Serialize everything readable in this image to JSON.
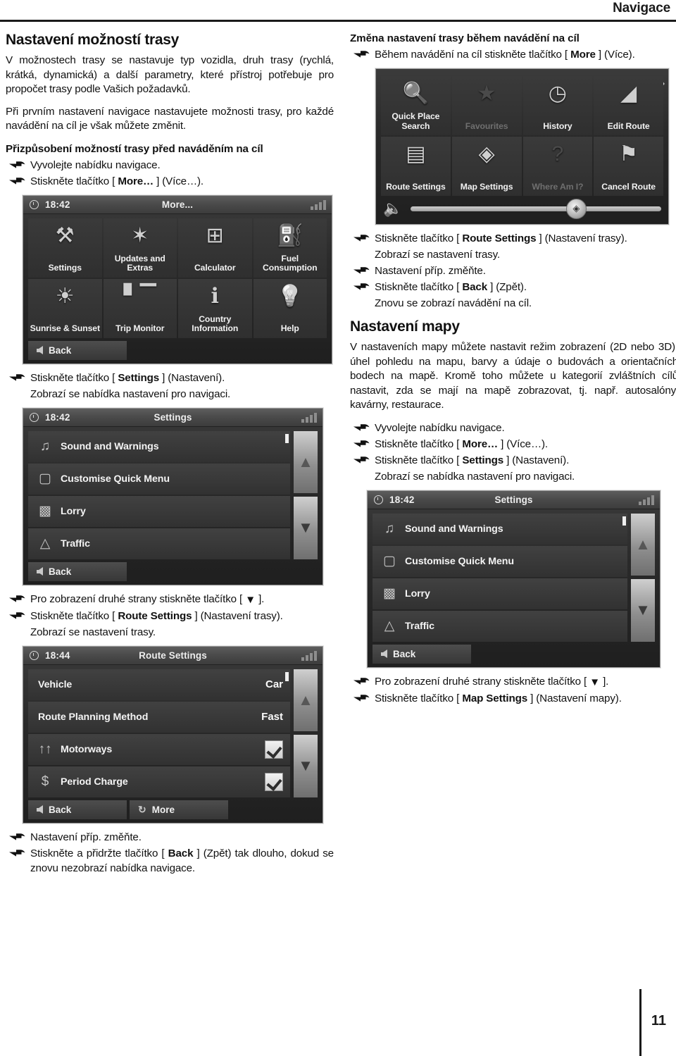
{
  "header": {
    "title": "Navigace"
  },
  "footer": {
    "page_number": "11"
  },
  "left": {
    "section_title": "Nastavení možností trasy",
    "intro_p1": "V možnostech trasy se nastavuje typ vozidla, druh trasy (rychlá, krátká, dynamická) a další parametry, které přístroj potřebuje pro propočet trasy podle Vašich požadavků.",
    "intro_p2": "Při prvním nastavení navigace nastavujete možnosti trasy, pro každé navádění na cíl je však můžete změnit.",
    "sub_title": "Přizpůsobení možností trasy před naváděním na cíl",
    "step1": "Vyvolejte nabídku navigace.",
    "step2_pre": "Stiskněte tlačítko [ ",
    "step2_bold": "More…",
    "step2_post": " ] (Více…).",
    "step3_pre": "Stiskněte tlačítko [ ",
    "step3_bold": "Settings",
    "step3_post": " ] (Nastavení).",
    "step3_note": "Zobrazí se nabídka nastavení pro navigaci.",
    "step4_pre": "Pro zobrazení druhé strany stiskněte tlačítko [ ",
    "step4_glyph": "▼",
    "step4_post": " ].",
    "step5_pre": "Stiskněte tlačítko [ ",
    "step5_bold": "Route Settings",
    "step5_post": " ] (Nastavení trasy).",
    "step5_note": "Zobrazí se nastavení trasy.",
    "step6": "Nastavení příp. změňte.",
    "step7_pre": "Stiskněte a přidržte tlačítko [ ",
    "step7_bold": "Back",
    "step7_post": " ] (Zpět) tak dlouho, dokud se znovu nezobrazí nabídka navigace."
  },
  "right": {
    "sub_title": "Změna nastavení trasy během navádění na cíl",
    "step1_pre": "Během navádění na cíl stiskněte tlačítko [ ",
    "step1_bold": "More",
    "step1_post": " ] (Více).",
    "step2_pre": "Stiskněte tlačítko [ ",
    "step2_bold": "Route Settings",
    "step2_post": " ] (Nastavení trasy).",
    "step2_note": "Zobrazí se nastavení trasy.",
    "step3": "Nastavení příp. změňte.",
    "step4_pre": "Stiskněte tlačítko [ ",
    "step4_bold": "Back",
    "step4_post": " ] (Zpět).",
    "step4_note": "Znovu se zobrazí navádění na cíl.",
    "section_title": "Nastavení mapy",
    "intro_p1": "V nastaveních mapy můžete nastavit režim zobrazení (2D nebo 3D), úhel pohledu na mapu, barvy a údaje o budovách a orientačních bodech na mapě. Kromě toho můžete u kategorií zvláštních cílů nastavit, zda se mají na mapě zobrazovat, tj. např. autosalóny, kavárny, restaurace.",
    "step5": "Vyvolejte nabídku navigace.",
    "step6_pre": "Stiskněte tlačítko [ ",
    "step6_bold": "More…",
    "step6_post": " ] (Více…).",
    "step7_pre": "Stiskněte tlačítko [ ",
    "step7_bold": "Settings",
    "step7_post": " ] (Nastavení).",
    "step7_note": "Zobrazí se nabídka nastavení pro navigaci.",
    "step8_pre": "Pro zobrazení druhé strany stiskněte tlačítko [ ",
    "step8_glyph": "▼",
    "step8_post": " ].",
    "step9_pre": "Stiskněte tlačítko [ ",
    "step9_bold": "Map Settings",
    "step9_post": " ] (Nastavení mapy)."
  },
  "screens": {
    "nav_menu": {
      "next_chevron": "›",
      "tiles": [
        {
          "label": "Quick Place Search",
          "icon": "magnifier-icon",
          "glyph": "🔍",
          "dim": false
        },
        {
          "label": "Favourites",
          "icon": "star-icon",
          "glyph": "★",
          "dim": true
        },
        {
          "label": "History",
          "icon": "clock-icon",
          "glyph": "◔",
          "dim": false
        },
        {
          "label": "Edit Route",
          "icon": "ruler-icon",
          "glyph": "◢",
          "dim": false
        },
        {
          "label": "Route Settings",
          "icon": "signboard-icon",
          "glyph": "⚑",
          "dim": false
        },
        {
          "label": "Map Settings",
          "icon": "map-eye-icon",
          "glyph": "◈",
          "dim": false
        },
        {
          "label": "Where Am I?",
          "icon": "question-map-icon",
          "glyph": "?",
          "dim": true
        },
        {
          "label": "Cancel Route",
          "icon": "checkered-flag-icon",
          "glyph": "⚑",
          "dim": false
        }
      ],
      "volume_icon": "speaker-icon"
    },
    "more_menu": {
      "time": "18:42",
      "title": "More...",
      "tiles": [
        {
          "label": "Settings",
          "icon": "tools-icon",
          "glyph": "⚒"
        },
        {
          "label": "Updates and Extras",
          "icon": "antenna-icon",
          "glyph": "✶"
        },
        {
          "label": "Calculator",
          "icon": "calculator-icon",
          "glyph": "⊞"
        },
        {
          "label": "Fuel Consumption",
          "icon": "fuel-can-icon",
          "glyph": "⛽"
        },
        {
          "label": "Sunrise & Sunset",
          "icon": "sun-clock-icon",
          "glyph": "☀"
        },
        {
          "label": "Trip Monitor",
          "icon": "bar-chart-icon",
          "glyph": "█"
        },
        {
          "label": "Country Information",
          "icon": "info-icon",
          "glyph": "ℹ"
        },
        {
          "label": "Help",
          "icon": "lightbulb-icon",
          "glyph": "●"
        }
      ],
      "back_label": "Back"
    },
    "settings": {
      "time": "18:42",
      "title": "Settings",
      "rows": [
        {
          "label": "Sound and Warnings",
          "icon": "speaker-icon",
          "glyph": "◔"
        },
        {
          "label": "Customise Quick Menu",
          "icon": "rounded-square-icon",
          "glyph": "▢"
        },
        {
          "label": "Lorry",
          "icon": "lorry-icon",
          "glyph": "▰"
        },
        {
          "label": "Traffic",
          "icon": "warning-triangle-icon",
          "glyph": "⚠"
        }
      ],
      "back_label": "Back",
      "scroll_up": "▲",
      "scroll_down": "▼"
    },
    "route_settings": {
      "time": "18:44",
      "title": "Route Settings",
      "rows": [
        {
          "label": "Vehicle",
          "value": "Car",
          "type": "value",
          "icon": ""
        },
        {
          "label": "Route Planning Method",
          "value": "Fast",
          "type": "value",
          "icon": ""
        },
        {
          "label": "Motorways",
          "value": "",
          "type": "checkbox",
          "icon": "motorway-icon",
          "glyph": "↑↑"
        },
        {
          "label": "Period Charge",
          "value": "",
          "type": "checkbox",
          "icon": "toll-icon",
          "glyph": "$"
        }
      ],
      "back_label": "Back",
      "more_label": "More",
      "scroll_up": "▲",
      "scroll_down": "▼"
    }
  }
}
